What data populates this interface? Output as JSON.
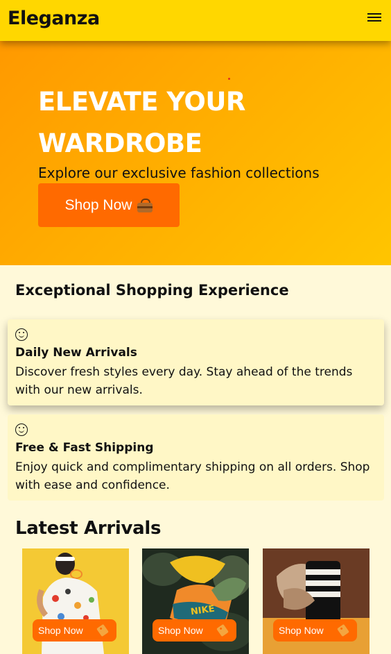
{
  "header": {
    "brand": "Eleganza",
    "menu_icon": "hamburger-menu-icon"
  },
  "hero": {
    "title": "ELEVATE YOUR WARDROBE",
    "subtitle": "Explore our exclusive fashion collections",
    "cta_label": "Shop Now",
    "cta_icon": "shopping-bag-icon"
  },
  "experience": {
    "heading": "Exceptional Shopping Experience",
    "features": [
      {
        "icon": "smiley-icon",
        "title": "Daily New Arrivals",
        "text": "Discover fresh styles every day. Stay ahead of the trends with our new arrivals."
      },
      {
        "icon": "smiley-icon",
        "title": "Free & Fast Shipping",
        "text": "Enjoy quick and complimentary shipping on all orders. Shop with ease and confidence."
      }
    ]
  },
  "latest": {
    "heading": "Latest Arrivals",
    "products": [
      {
        "button": "Shop Now",
        "icon": "price-tag-icon"
      },
      {
        "button": "Shop Now",
        "icon": "price-tag-icon"
      },
      {
        "button": "Shop Now",
        "icon": "price-tag-icon"
      }
    ]
  },
  "colors": {
    "header": "#ffd700",
    "accent": "#ff6a00",
    "background": "#fff9d9",
    "card": "#fff7c6"
  }
}
